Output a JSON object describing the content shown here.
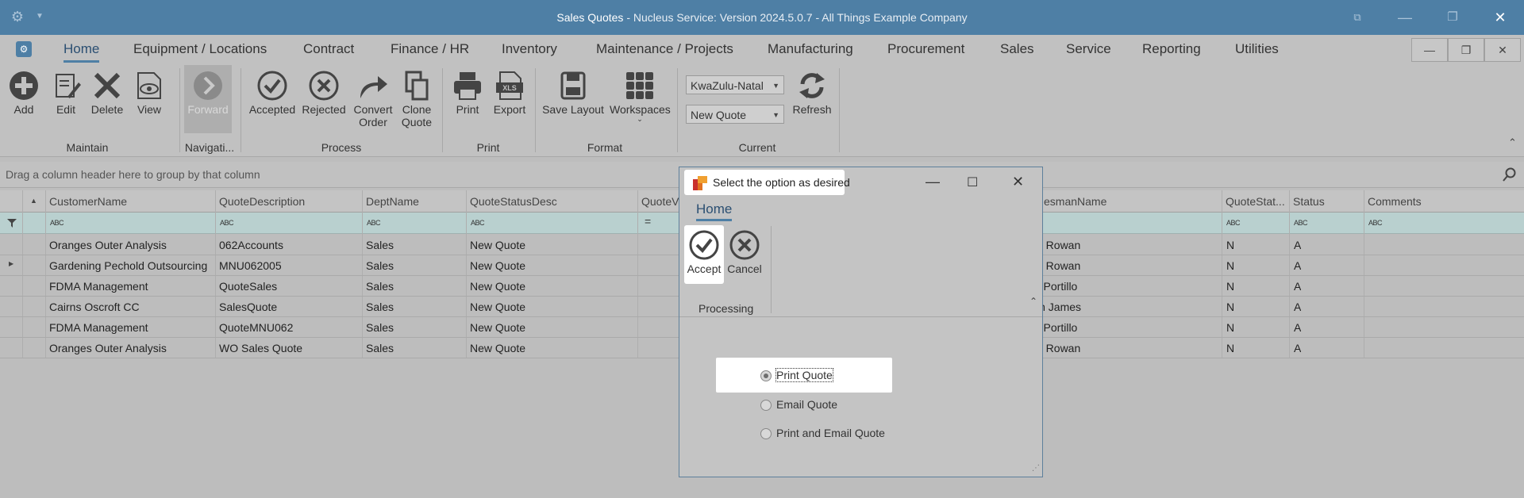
{
  "window": {
    "title_app": "Sales Quotes",
    "title_rest": " - Nucleus Service: Version 2024.5.0.7 - All Things Example Company"
  },
  "menu": {
    "items": [
      "Home",
      "Equipment / Locations",
      "Contract",
      "Finance / HR",
      "Inventory",
      "Maintenance / Projects",
      "Manufacturing",
      "Procurement",
      "Sales",
      "Service",
      "Reporting",
      "Utilities"
    ],
    "active": "Home"
  },
  "ribbon": {
    "maintain": {
      "label": "Maintain",
      "add": "Add",
      "edit": "Edit",
      "delete": "Delete",
      "view": "View"
    },
    "navigation": {
      "label": "Navigati...",
      "forward": "Forward"
    },
    "process": {
      "label": "Process",
      "accepted": "Accepted",
      "rejected": "Rejected",
      "convert_1": "Convert",
      "convert_2": "Order",
      "clone_1": "Clone",
      "clone_2": "Quote"
    },
    "print": {
      "label": "Print",
      "print": "Print",
      "export": "Export",
      "xls": "XLS"
    },
    "format": {
      "label": "Format",
      "save_layout": "Save Layout",
      "workspaces": "Workspaces"
    },
    "current": {
      "label": "Current",
      "region": "KwaZulu-Natal",
      "status": "New Quote",
      "refresh": "Refresh"
    }
  },
  "grid": {
    "group_hint": "Drag a column header here to group by that column",
    "columns": [
      "CustomerName",
      "QuoteDescription",
      "DeptName",
      "QuoteStatusDesc",
      "QuoteVa",
      "esmanName",
      "QuoteStat...",
      "Status",
      "Comments"
    ],
    "filter_glyph": "ABC",
    "rows": [
      [
        "Oranges Outer Analysis",
        "062Accounts",
        "Sales",
        "New Quote",
        "n Rowan",
        "N",
        "A"
      ],
      [
        "Gardening Pechold Outsourcing",
        "MNU062005",
        "Sales",
        "New Quote",
        "n Rowan",
        "N",
        "A"
      ],
      [
        "FDMA Management",
        "QuoteSales",
        "Sales",
        "New Quote",
        "r Portillo",
        "N",
        "A"
      ],
      [
        "Cairns Oscroft CC",
        "SalesQuote",
        "Sales",
        "New Quote",
        "in James",
        "N",
        "A"
      ],
      [
        "FDMA Management",
        "QuoteMNU062",
        "Sales",
        "New Quote",
        "r Portillo",
        "N",
        "A"
      ],
      [
        "Oranges Outer Analysis",
        "WO Sales Quote",
        "Sales",
        "New Quote",
        "n Rowan",
        "N",
        "A"
      ]
    ]
  },
  "dialog": {
    "title": "Select the option as desired",
    "tab": "Home",
    "accept": "Accept",
    "cancel": "Cancel",
    "group": "Processing",
    "options": [
      "Print Quote",
      "Email Quote",
      "Print and Email Quote"
    ],
    "selected_index": 0
  },
  "colors": {
    "titlebar": "#4e7fa5",
    "accent": "#2b4f72",
    "filter_row": "#b9d0cf"
  }
}
